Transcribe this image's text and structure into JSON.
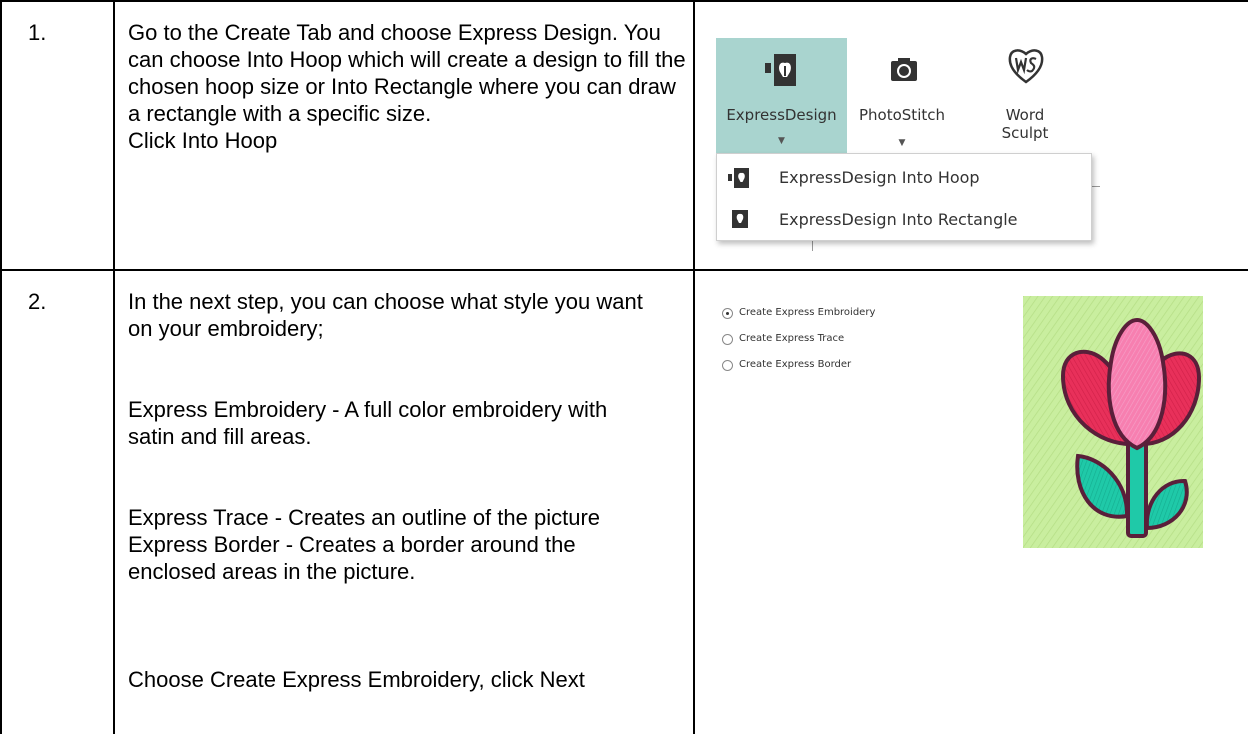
{
  "rows": [
    {
      "number": "1.",
      "paragraphs": [
        "Go to the Create Tab and choose Express Design. You can choose Into Hoop which will create a design to fill the chosen hoop size or Into Rectangle where you can draw a rectangle with a specific size.\nClick Into Hoop"
      ]
    },
    {
      "number": "2.",
      "paragraphs": [
        "In the next step, you can choose what style you want on your embroidery;",
        "Express Embroidery - A full color embroidery with satin and fill areas.",
        "Express Trace - Creates an outline of the picture\nExpress Border - Creates a border around the enclosed areas in the picture.",
        "Choose Create Express Embroidery, click Next"
      ]
    }
  ],
  "ribbon": {
    "buttons": [
      {
        "label": "ExpressDesign",
        "icon": "express-design-icon",
        "active": true
      },
      {
        "label": "PhotoStitch",
        "icon": "camera-icon",
        "active": false
      },
      {
        "label": "Word\nSculpt",
        "icon": "word-sculpt-icon",
        "active": false
      }
    ],
    "menu": [
      {
        "label": "ExpressDesign Into Hoop",
        "icon": "express-design-hoop-icon"
      },
      {
        "label": "ExpressDesign Into Rectangle",
        "icon": "express-design-rectangle-icon"
      }
    ],
    "colors": {
      "active_bg": "#a9d4cf",
      "icon_dark": "#333333"
    }
  },
  "options": {
    "radios": [
      {
        "label": "Create Express Embroidery",
        "selected": true
      },
      {
        "label": "Create Express Trace",
        "selected": false
      },
      {
        "label": "Create Express Border",
        "selected": false
      }
    ]
  },
  "preview": {
    "icon": "tulip-embroidery-preview",
    "colors": {
      "background": "#c9ee9f",
      "petal": "#e8305a",
      "center_petal": "#f77fb0",
      "leaf": "#1fc9a8",
      "outline": "#5a1f3a"
    }
  }
}
